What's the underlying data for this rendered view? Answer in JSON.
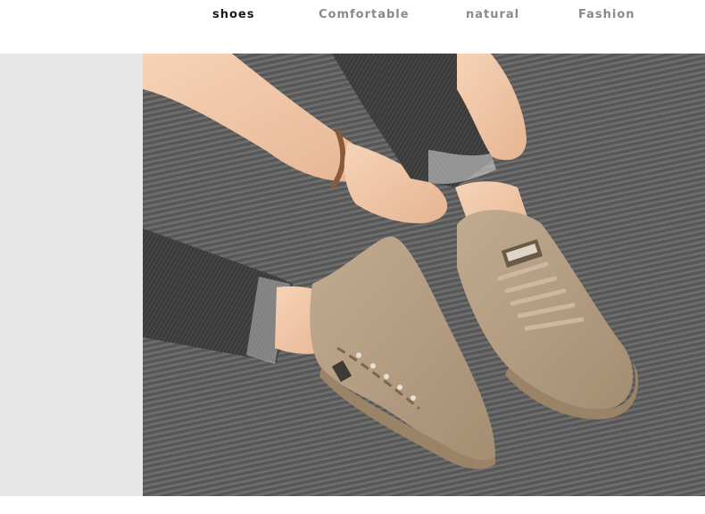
{
  "nav": {
    "items": [
      {
        "label": "shoes",
        "active": true
      },
      {
        "label": "Comfortable",
        "active": false
      },
      {
        "label": "natural",
        "active": false
      },
      {
        "label": "Fashion",
        "active": false
      }
    ]
  },
  "photo": {
    "subject": "person in dark jeans tying laces of beige suede sneakers on grey carpet",
    "colors": {
      "carpet": "#5f5f5f",
      "shoe": "#b49e84",
      "skin": "#f0c7a7",
      "denim": "#3a3a3a"
    }
  },
  "colors": {
    "nav_active": "#1a1a1a",
    "nav_inactive": "#8a8a8a",
    "side_panel": "#e7e7e7"
  }
}
